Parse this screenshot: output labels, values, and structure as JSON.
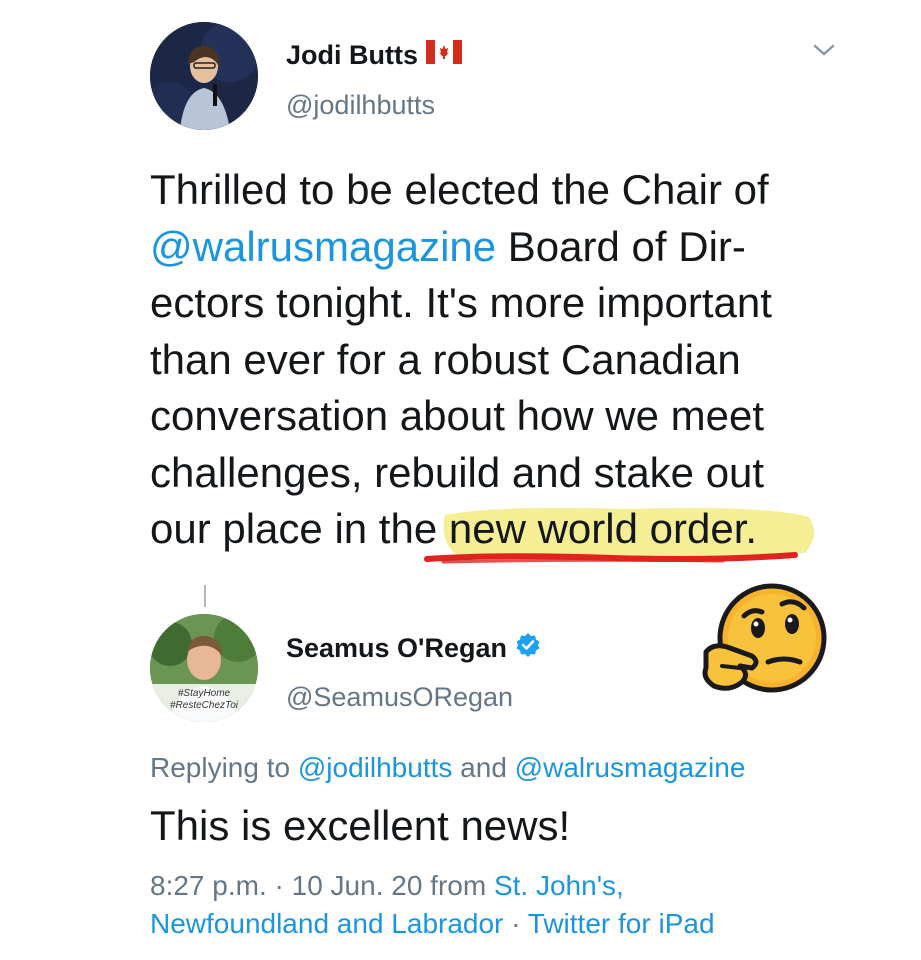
{
  "tweet": {
    "author_name": "Jodi Butts",
    "author_flag": "canada-flag-icon",
    "author_handle": "@jodilhbutts",
    "text_line1": "Thrilled to be elected the Chair of",
    "mention": "@walrusmagazine",
    "text_line2_rest": " Board of Dir-",
    "text_line3": "ectors tonight. It's more important",
    "text_line4": "than ever for a robust Canadian",
    "text_line5": "conversation about how we meet",
    "text_line6": "challenges, rebuild and stake out",
    "text_line7_start": "our place in the ",
    "highlighted_phrase": "new world order."
  },
  "reply": {
    "author_name": "Seamus O'Regan",
    "verified_icon": "verified-badge-icon",
    "author_handle": "@SeamusORegan",
    "avatar_caption_line1": "#StayHome",
    "avatar_caption_line2": "#ResteChezToi",
    "replying_prefix": "Replying to ",
    "replying_user1": "@jodilhbutts",
    "replying_and": " and ",
    "replying_user2": "@walrusmagazine",
    "text": "This is excellent news!",
    "time": "8:27 p.m.",
    "sep1": " · ",
    "date": "10 Jun. 20",
    "from_word": " from ",
    "location_part1": "St. John's,",
    "location_part2": "Newfoundland and Labrador",
    "sep2": " · ",
    "source": "Twitter for iPad"
  },
  "annotation": {
    "emoji_icon": "thinking-face-emoji-icon"
  },
  "colors": {
    "link": "#1b95e0",
    "secondary_text": "#657786",
    "highlight": "#f4ec88",
    "underline": "#e0231f"
  }
}
